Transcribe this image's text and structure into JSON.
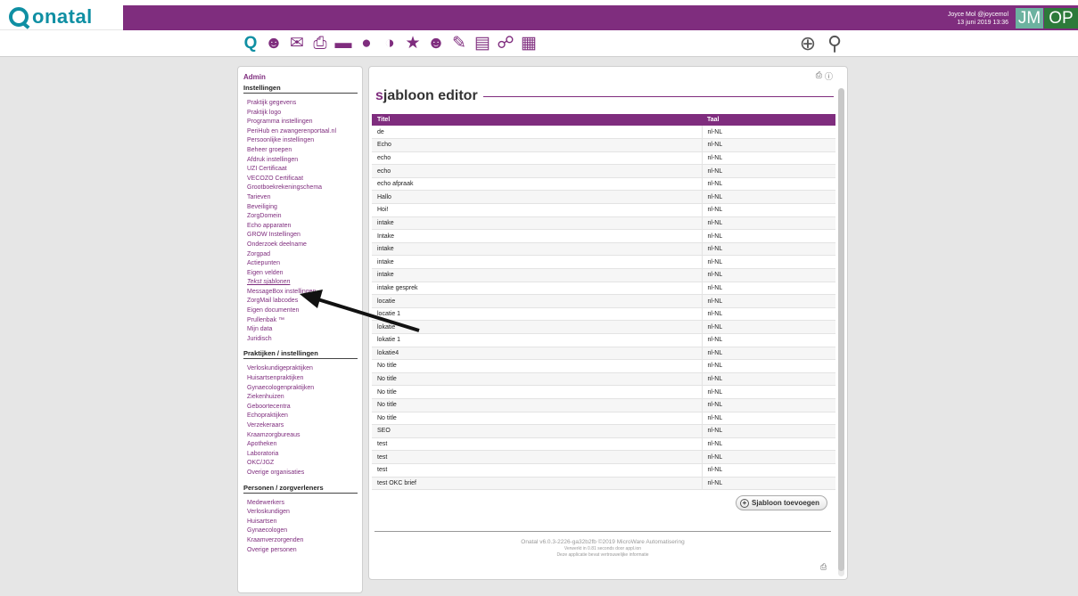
{
  "header": {
    "logo_text": "onatal",
    "user_line": "Joyce Mol @joycemol",
    "datetime": "13 juni 2019 13:36",
    "avatar_1": "JM",
    "avatar_2": "OP",
    "brand_color": "#7f2d7e",
    "logo_color": "#0f8fa3"
  },
  "toolbar": {
    "icons": [
      "search-icon",
      "people-icon",
      "mail-icon",
      "printer-icon",
      "card-icon",
      "chat-icon",
      "pie-chart-icon",
      "star-icon",
      "group-icon",
      "speech-icon",
      "calendar-icon",
      "globe-icon",
      "calculator-icon"
    ],
    "right_icons": [
      "add-icon",
      "magnifier-icon"
    ]
  },
  "sidebar": {
    "admin": "Admin",
    "sections": [
      {
        "title": "Instellingen",
        "items": [
          "Praktijk gegevens",
          "Praktijk logo",
          "Programma instellingen",
          "PeriHub en zwangerenportaal.nl",
          "Persoonlijke instellingen",
          "Beheer groepen",
          "Afdruk instellingen",
          "UZI Certificaat",
          "VECOZO Certificaat",
          "Grootboekrekeningschema",
          "Tarieven",
          "Beveiliging",
          "ZorgDomein",
          "Echo apparaten",
          "GROW Instellingen",
          "Onderzoek deelname",
          "Zorgpad",
          "Actiepunten",
          "Eigen velden",
          "Tekst sjablonen",
          "MessageBox instellingen",
          "ZorgMail labcodes",
          "Eigen documenten",
          "Prullenbak ™",
          "Mijn data",
          "Juridisch"
        ]
      },
      {
        "title": "Praktijken / instellingen",
        "items": [
          "Verloskundigepraktijken",
          "Huisartsenpraktijken",
          "Gynaecologenpraktijken",
          "Ziekenhuizen",
          "Geboortecentra",
          "Echopraktijken",
          "Verzekeraars",
          "Kraamzorgbureaus",
          "Apotheken",
          "Laboratoria",
          "OKC/JGZ",
          "Overige organisaties"
        ]
      },
      {
        "title": "Personen / zorgverleners",
        "items": [
          "Medewerkers",
          "Verloskundigen",
          "Huisartsen",
          "Gynaecologen",
          "Kraamverzorgenden",
          "Overige personen"
        ]
      }
    ],
    "active_item": "Tekst sjablonen"
  },
  "main": {
    "title_first": "s",
    "title_rest": "jabloon editor",
    "columns": [
      "Titel",
      "Taal"
    ],
    "rows": [
      [
        "de",
        "nl-NL"
      ],
      [
        "Echo",
        "nl-NL"
      ],
      [
        "echo",
        "nl-NL"
      ],
      [
        "echo",
        "nl-NL"
      ],
      [
        "echo afpraak",
        "nl-NL"
      ],
      [
        "Hallo",
        "nl-NL"
      ],
      [
        "Hoi!",
        "nl-NL"
      ],
      [
        "intake",
        "nl-NL"
      ],
      [
        "Intake",
        "nl-NL"
      ],
      [
        "intake",
        "nl-NL"
      ],
      [
        "intake",
        "nl-NL"
      ],
      [
        "intake",
        "nl-NL"
      ],
      [
        "intake gesprek",
        "nl-NL"
      ],
      [
        "locatie",
        "nl-NL"
      ],
      [
        "locatie 1",
        "nl-NL"
      ],
      [
        "lokatie",
        "nl-NL"
      ],
      [
        "lokatie 1",
        "nl-NL"
      ],
      [
        "lokatie4",
        "nl-NL"
      ],
      [
        "No title",
        "nl-NL"
      ],
      [
        "No title",
        "nl-NL"
      ],
      [
        "No title",
        "nl-NL"
      ],
      [
        "No title",
        "nl-NL"
      ],
      [
        "No title",
        "nl-NL"
      ],
      [
        "SEO",
        "nl-NL"
      ],
      [
        "test",
        "nl-NL"
      ],
      [
        "test",
        "nl-NL"
      ],
      [
        "test",
        "nl-NL"
      ],
      [
        "test OKC brief",
        "nl-NL"
      ]
    ],
    "add_button": "Sjabloon toevoegen",
    "footer_line1": "Onatal v6.0.3-2226-ga32b2fb ©2019 MicroWare Automatisering",
    "footer_line2": "Verwerkt in 0.81 seconds door appl.ion",
    "footer_line3": "Deze applicatie bevat vertrouwelijke informatie"
  }
}
